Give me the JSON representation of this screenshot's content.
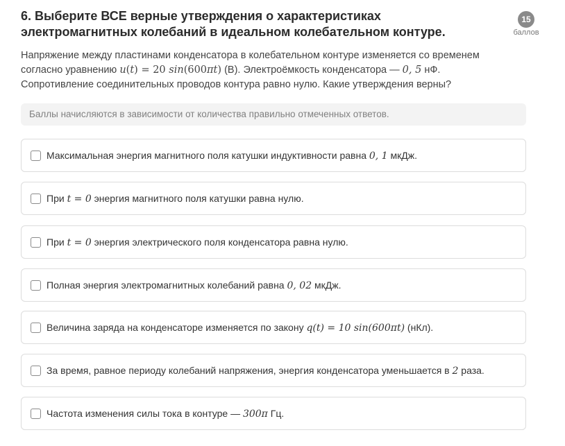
{
  "question": {
    "title": "6. Выберите ВСЕ верные утверждения о характеристиках электромагнитных колебаний в идеальном колебательном контуре.",
    "points_value": "15",
    "points_caption": "баллов",
    "text": {
      "t1": "Напряжение между пластинами конденсатора в колебательном контуре изменяется со временем согласно уравнению ",
      "m1a": "u",
      "m1b": "(",
      "m1c": "t",
      "m1d": ") = 20 ",
      "m1e": "sin",
      "m1f": "(600",
      "m1g": "πt",
      "m1h": ")",
      "t2": " (В). Электроёмкость конденсатора — ",
      "m2": "0, 5",
      "t3": " нФ. Сопротивление соединительных проводов контура равно нулю. Какие утверждения верны?"
    },
    "hint": "Баллы начисляются в зависимости от количества правильно отмеченных ответов."
  },
  "options": [
    {
      "pre": "Максимальная энергия магнитного поля катушки индуктивности равна ",
      "math": "0, 1",
      "post": " мкДж."
    },
    {
      "pre": "При ",
      "math": "t = 0",
      "post": " энергия магнитного поля катушки равна нулю."
    },
    {
      "pre": "При ",
      "math": "t = 0",
      "post": " энергия электрического поля конденсатора равна нулю."
    },
    {
      "pre": "Полная энергия электромагнитных колебаний равна ",
      "math": "0, 02",
      "post": " мкДж."
    },
    {
      "pre": "Величина заряда на конденсаторе изменяется по закону ",
      "math": "q(t) = 10 sin(600πt)",
      "post": " (нКл)."
    },
    {
      "pre": "За время, равное периоду колебаний напряжения, энергия конденсатора уменьшается в ",
      "math": "2",
      "post": " раза."
    },
    {
      "pre": "Частота изменения силы тока в контуре — ",
      "math": "300π",
      "post": " Гц."
    }
  ]
}
